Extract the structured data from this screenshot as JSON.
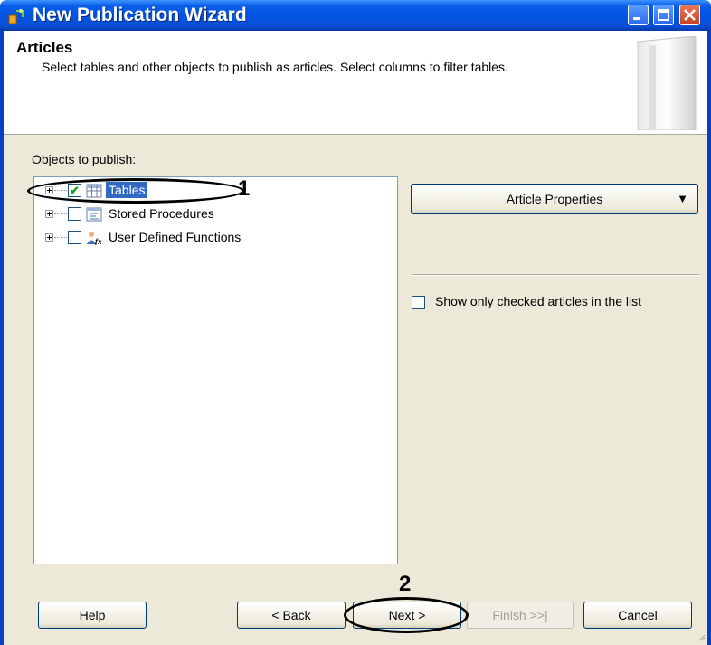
{
  "window": {
    "title": "New Publication Wizard",
    "controls": [
      "minimize-icon",
      "maximize-icon",
      "close-icon"
    ]
  },
  "header": {
    "title": "Articles",
    "description": "Select tables and other objects to publish as articles. Select columns to filter tables."
  },
  "objects": {
    "label": "Objects to publish:",
    "items": [
      {
        "label": "Tables",
        "checked": true,
        "selected": true,
        "icon": "table-icon"
      },
      {
        "label": "Stored Procedures",
        "checked": false,
        "selected": false,
        "icon": "stored-procedure-icon"
      },
      {
        "label": "User Defined Functions",
        "checked": false,
        "selected": false,
        "icon": "user-function-icon"
      }
    ]
  },
  "article_properties": {
    "label": "Article Properties",
    "arrow": "▼"
  },
  "show_only": {
    "label": "Show only checked articles in the list",
    "checked": false
  },
  "annotations": {
    "first": "1",
    "second": "2"
  },
  "buttons": {
    "help": "Help",
    "back": "< Back",
    "next": "Next >",
    "finish": "Finish >>|",
    "cancel": "Cancel"
  },
  "colors": {
    "titlebar": "#0054e3",
    "selection": "#316ac5",
    "dialog": "#ece9d8"
  }
}
